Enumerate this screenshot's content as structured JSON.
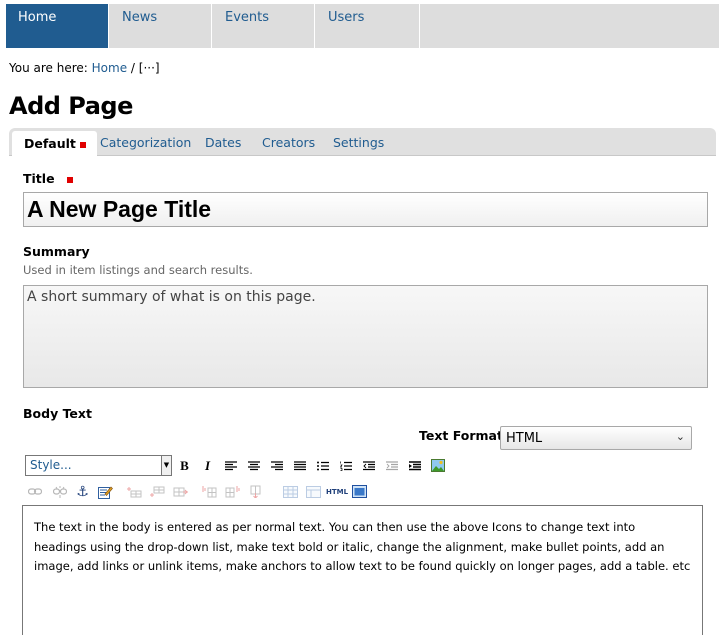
{
  "nav": {
    "tabs": [
      {
        "label": "Home",
        "active": true
      },
      {
        "label": "News"
      },
      {
        "label": "Events"
      },
      {
        "label": "Users"
      }
    ]
  },
  "breadcrumb": {
    "prefix": "You are here:",
    "home": "Home",
    "separator": "/",
    "current": "[···]"
  },
  "page": {
    "title": "Add Page"
  },
  "form_tabs": [
    {
      "label": "Default",
      "active": true,
      "required": true
    },
    {
      "label": "Categorization"
    },
    {
      "label": "Dates"
    },
    {
      "label": "Creators"
    },
    {
      "label": "Settings"
    }
  ],
  "fields": {
    "title": {
      "label": "Title",
      "value": "A New Page Title"
    },
    "summary": {
      "label": "Summary",
      "help": "Used in item listings and search results.",
      "value": "A short summary of what is on this page."
    },
    "body": {
      "label": "Body Text",
      "text_format_label": "Text Format",
      "text_format_value": "HTML",
      "style_placeholder": "Style...",
      "content": "The text in the body is entered as per normal text.  You can then use the above Icons to change text into headings using the drop-down list, make text bold or italic, change the alignment, make bullet points, add an image, add links or unlink items, make anchors to allow text to be found quickly on longer pages, add a table. etc"
    }
  },
  "toolbar": {
    "bold": "B",
    "italic": "I",
    "html": "HTML"
  },
  "colors": {
    "accent": "#205c90",
    "required": "#e00000",
    "nav_bg": "#dddddd"
  }
}
